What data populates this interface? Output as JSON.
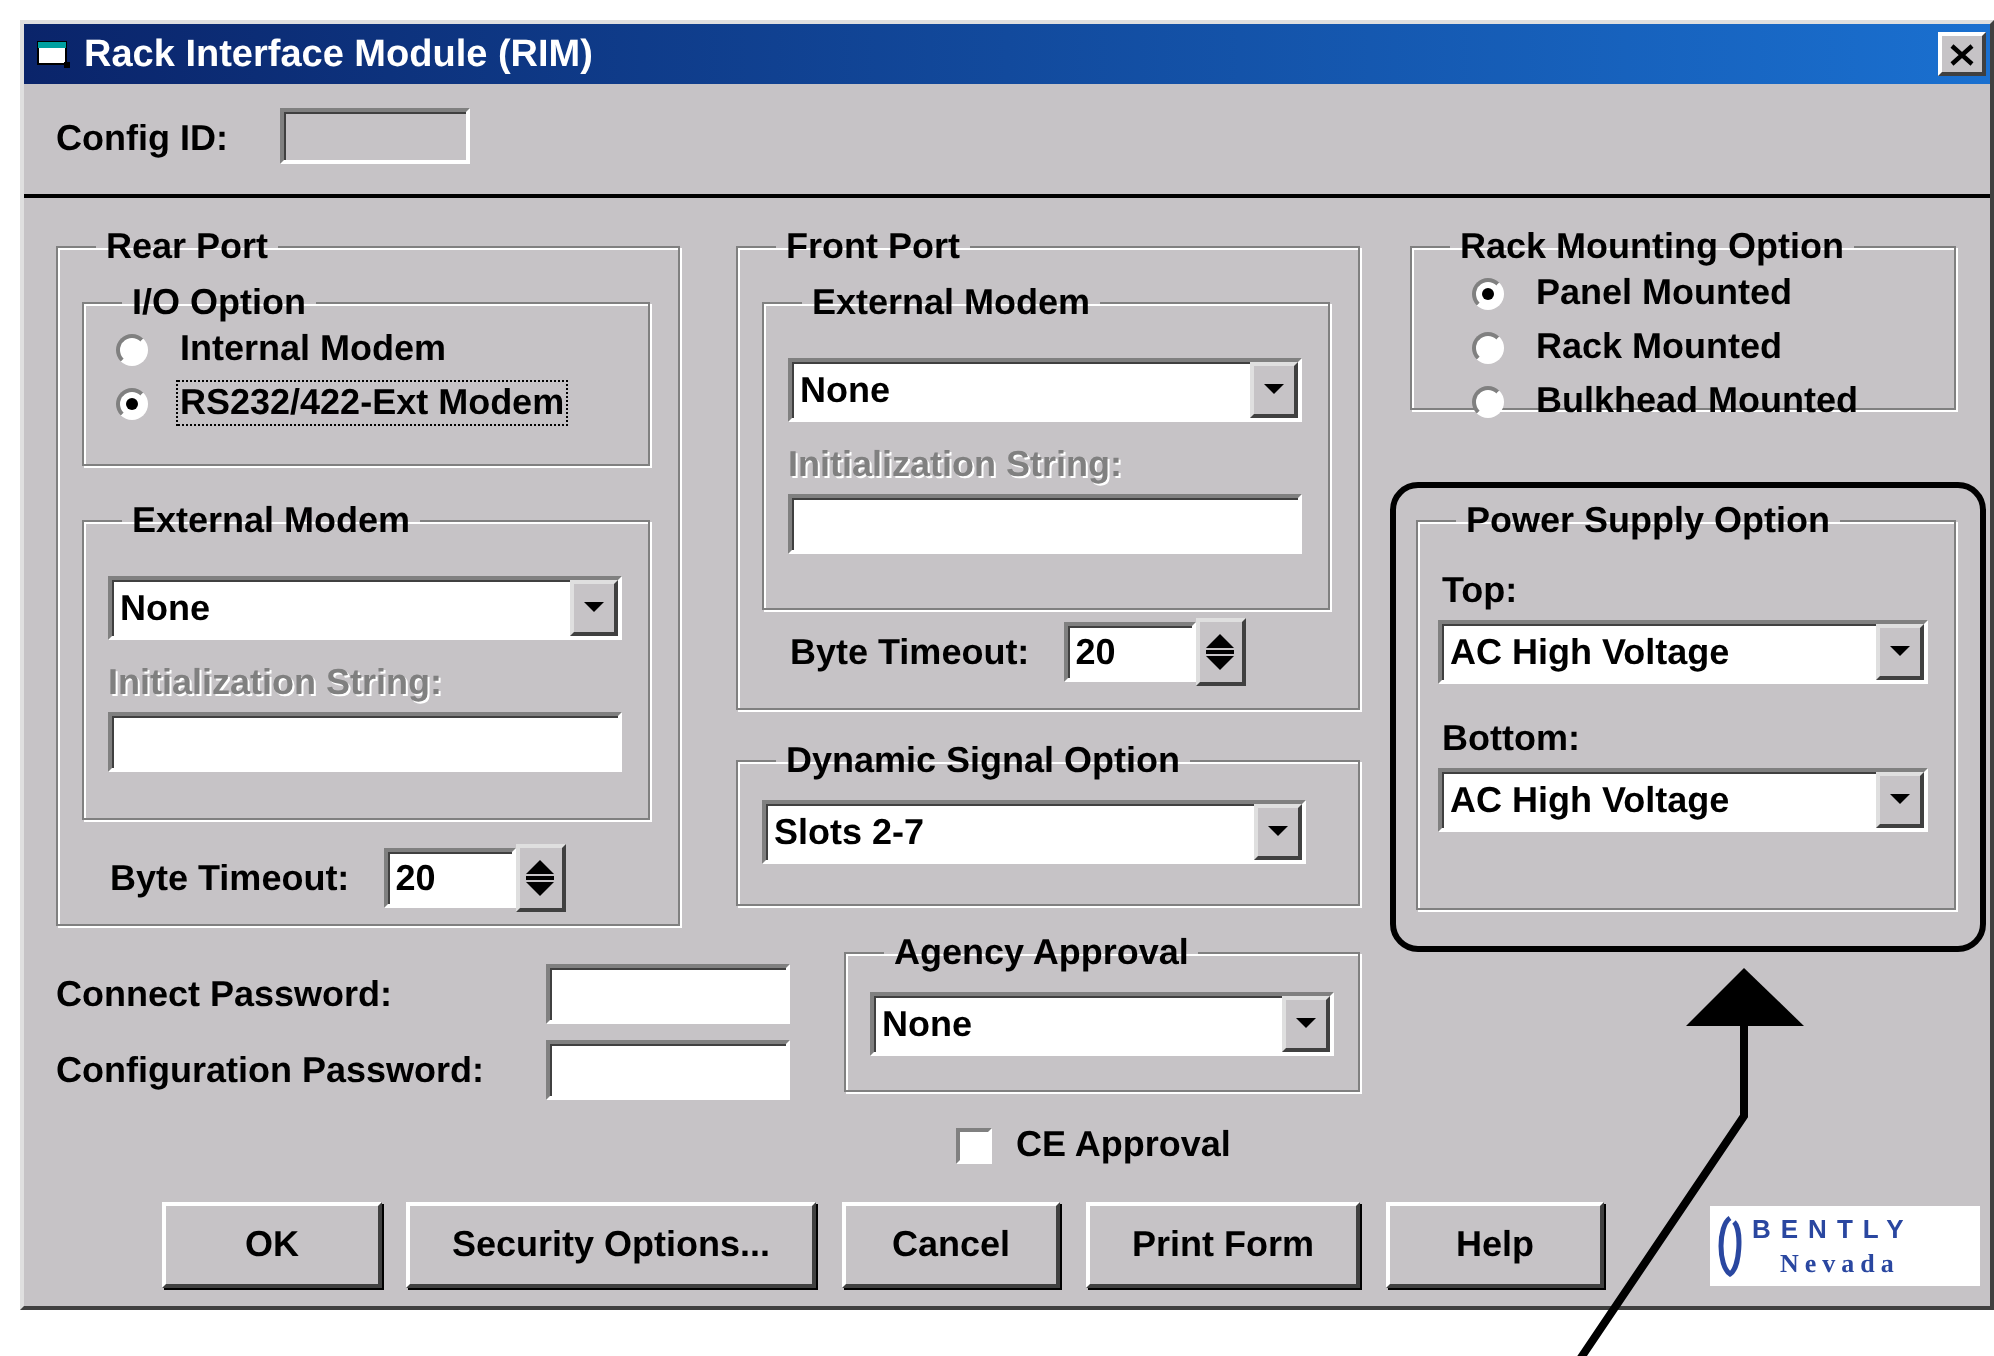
{
  "window": {
    "title": "Rack Interface Module (RIM)"
  },
  "config_id": {
    "label": "Config ID:",
    "disabled": true
  },
  "rear_port": {
    "title": "Rear Port",
    "io_option": {
      "title": "I/O Option",
      "options": [
        {
          "label": "Internal Modem",
          "selected": false,
          "focused": false
        },
        {
          "label": "RS232/422-Ext Modem",
          "selected": true,
          "focused": true
        }
      ]
    },
    "external_modem": {
      "title": "External Modem",
      "value": "None",
      "init_label": "Initialization String:",
      "init_disabled": true
    },
    "byte_timeout": {
      "label": "Byte Timeout:",
      "value": "20"
    }
  },
  "front_port": {
    "title": "Front Port",
    "external_modem": {
      "title": "External Modem",
      "value": "None",
      "init_label": "Initialization String:",
      "init_disabled": true
    },
    "byte_timeout": {
      "label": "Byte Timeout:",
      "value": "20"
    }
  },
  "dynamic_signal": {
    "title": "Dynamic Signal Option",
    "value": "Slots 2-7"
  },
  "passwords": [
    {
      "label": "Connect Password:"
    },
    {
      "label": "Configuration Password:"
    }
  ],
  "agency_approval": {
    "title": "Agency Approval",
    "value": "None"
  },
  "ce_approval": {
    "label": "CE Approval",
    "checked": false
  },
  "rack_mounting": {
    "title": "Rack Mounting Option",
    "options": [
      {
        "label": "Panel Mounted",
        "selected": true
      },
      {
        "label": "Rack Mounted",
        "selected": false
      },
      {
        "label": "Bulkhead Mounted",
        "selected": false
      }
    ]
  },
  "power_supply": {
    "title": "Power Supply Option",
    "highlighted": true,
    "fields": [
      {
        "label": "Top:",
        "value": "AC High Voltage"
      },
      {
        "label": "Bottom:",
        "value": "AC High Voltage"
      }
    ]
  },
  "buttons": [
    {
      "label": "OK"
    },
    {
      "label": "Security Options..."
    },
    {
      "label": "Cancel"
    },
    {
      "label": "Print Form"
    },
    {
      "label": "Help"
    }
  ],
  "logo": {
    "name": "BENTLY",
    "subtitle": "Nevada"
  }
}
